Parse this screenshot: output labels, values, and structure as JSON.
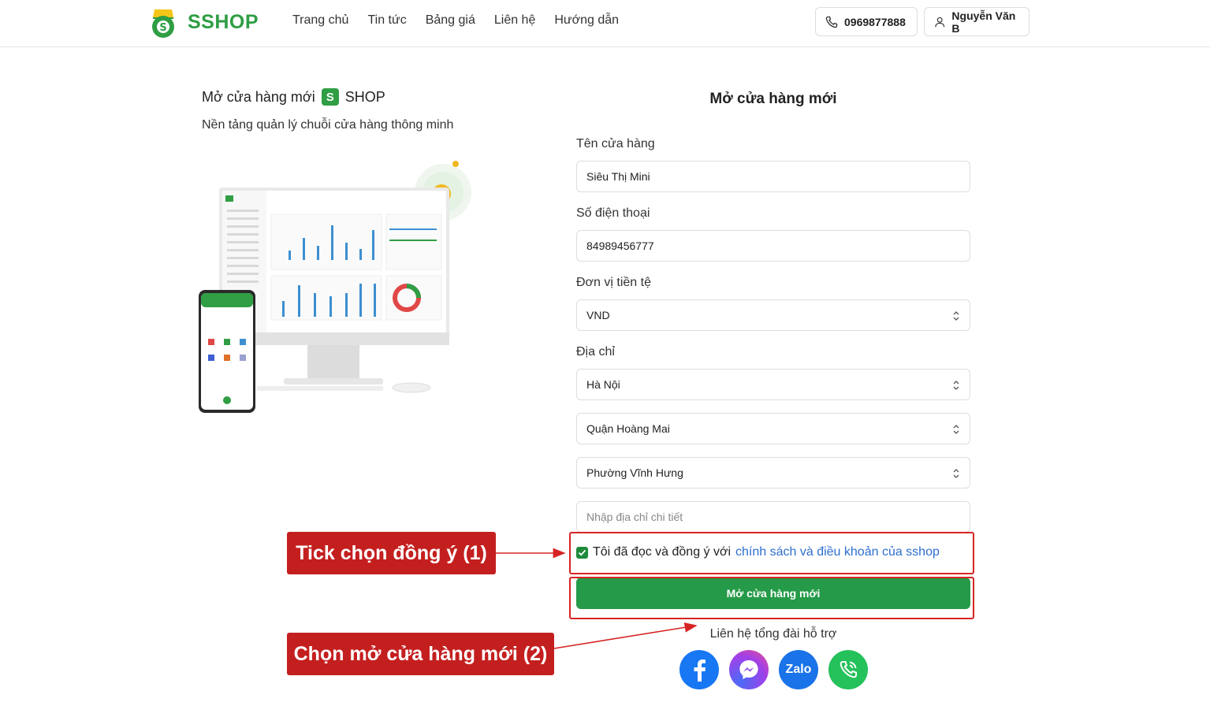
{
  "header": {
    "logo_text": "SSHOP",
    "nav": [
      "Trang chủ",
      "Tin tức",
      "Bảng giá",
      "Liên hệ",
      "Hướng dẫn"
    ],
    "phone": "0969877888",
    "user": "Nguyễn Văn B"
  },
  "promo": {
    "title_prefix": "Mở cửa hàng mới",
    "badge": "S",
    "title_suffix": "SHOP",
    "subtitle": "Nền tảng quản lý chuỗi cửa hàng thông minh"
  },
  "form": {
    "title": "Mở cửa hàng mới",
    "store_name_label": "Tên cửa hàng",
    "store_name_value": "Siêu Thị Mini",
    "phone_label": "Số điện thoại",
    "phone_value": "84989456777",
    "currency_label": "Đơn vị tiền tệ",
    "currency_value": "VND",
    "address_label": "Địa chỉ",
    "province_value": "Hà Nội",
    "district_value": "Quận Hoàng Mai",
    "ward_value": "Phường Vĩnh Hưng",
    "detail_placeholder": "Nhập địa chỉ chi tiết",
    "agree_text": "Tôi đã đọc và đồng ý với",
    "agree_link": "chính sách và điều khoản của sshop",
    "agree_checked": true,
    "submit_label": "Mở cửa hàng mới"
  },
  "support": {
    "text": "Liên hệ tổng đài hỗ trợ",
    "zalo_label": "Zalo",
    "icons": [
      "facebook-icon",
      "messenger-icon",
      "zalo-icon",
      "phone-call-icon"
    ]
  },
  "annotations": {
    "step1": "Tick chọn đồng ý (1)",
    "step2": "Chọn mở cửa hàng mới (2)"
  },
  "colors": {
    "brand_green": "#2f9e44",
    "button_green": "#259a48",
    "link_blue": "#2e6fd0",
    "annotation_red": "#c41f1f",
    "facebook": "#1877f2",
    "zalo": "#1a73e8",
    "call": "#25c15a"
  }
}
